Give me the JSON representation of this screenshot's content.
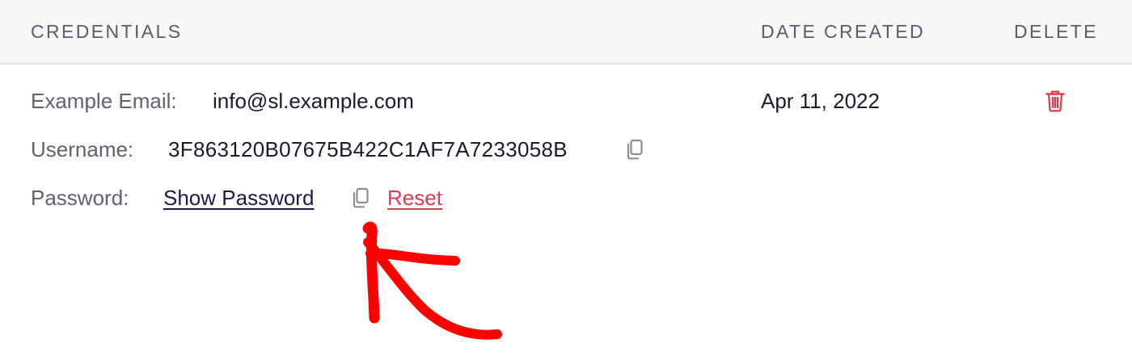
{
  "header": {
    "credentials": "CREDENTIALS",
    "date_created": "DATE CREATED",
    "delete": "DELETE"
  },
  "row": {
    "email_label": "Example Email:",
    "email_value": "info@sl.example.com",
    "username_label": "Username:",
    "username_value": "3F863120B07675B422C1AF7A7233058B",
    "password_label": "Password:",
    "show_password": "Show Password",
    "reset": "Reset",
    "date": "Apr 11, 2022"
  },
  "icons": {
    "copy_username": "copy-icon",
    "copy_password": "copy-icon",
    "delete": "trash-icon"
  },
  "colors": {
    "header_bg": "#f7f7f8",
    "header_text": "#5a5b6e",
    "label_text": "#5f6070",
    "value_text": "#1a1a2a",
    "link": "#1e1a45",
    "danger": "#e0394f",
    "annotation_arrow": "#ff0000"
  }
}
